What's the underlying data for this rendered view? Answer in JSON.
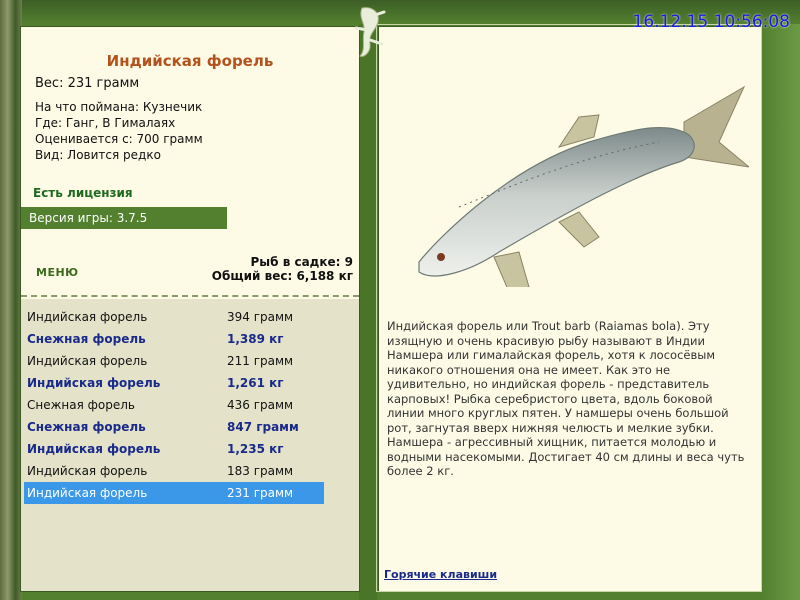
{
  "datetime": "16.12.15 10:56:08",
  "fish_card": {
    "title": "Индийская форель",
    "weight": "Вес: 231 грамм",
    "caught_on": "На что поймана: Кузнечик",
    "location": "Где: Ганг, В Гималаях",
    "valued_from": "Оценивается с: 700 грамм",
    "rarity": "Вид: Ловится редко"
  },
  "license": "Есть лицензия",
  "version": "Версия игры: 3.7.5",
  "menu_label": "МЕНЮ",
  "stats": {
    "fish_count": "Рыб в садке: 9",
    "total_weight": "Общий вес: 6,188 кг"
  },
  "catch_list": [
    {
      "name": "Индийская форель",
      "weight": "394 грамм",
      "bold": false,
      "selected": false
    },
    {
      "name": "Снежная форель",
      "weight": "1,389 кг",
      "bold": true,
      "selected": false
    },
    {
      "name": "Индийская форель",
      "weight": "211 грамм",
      "bold": false,
      "selected": false
    },
    {
      "name": "Индийская форель",
      "weight": "1,261 кг",
      "bold": true,
      "selected": false
    },
    {
      "name": "Снежная форель",
      "weight": "436 грамм",
      "bold": false,
      "selected": false
    },
    {
      "name": "Снежная форель",
      "weight": "847 грамм",
      "bold": true,
      "selected": false
    },
    {
      "name": "Индийская форель",
      "weight": "1,235 кг",
      "bold": true,
      "selected": false
    },
    {
      "name": "Индийская форель",
      "weight": "183 грамм",
      "bold": false,
      "selected": false
    },
    {
      "name": "Индийская форель",
      "weight": "231 грамм",
      "bold": false,
      "selected": true
    }
  ],
  "description": "Индийская форель или Trout barb (Raiamas bola). Эту изящную и очень красивую рыбу называют в Индии Намшера или гималайская форель, хотя к лососёвым никакого отношения она не имеет. Как это не удивительно, но индийская форель - представитель карповых! Рыбка серебристого цвета, вдоль боковой линии много круглых пятен. У намшеры очень большой рот, загнутая вверх нижняя челюсть и мелкие зубки. Намшера - агрессивный хищник, питается молодью и водными насекомыми. Достигает 40 см длины и веса чуть более 2 кг.",
  "hotkeys": "Горячие клавиши",
  "colors": {
    "frame_green": "#53802f",
    "panel_bg": "#fdfbe6",
    "title_orange": "#b4521c",
    "selected_row": "#3b97e8",
    "bold_row_text": "#1a2a8a",
    "datetime_blue": "#1a1ae0"
  }
}
